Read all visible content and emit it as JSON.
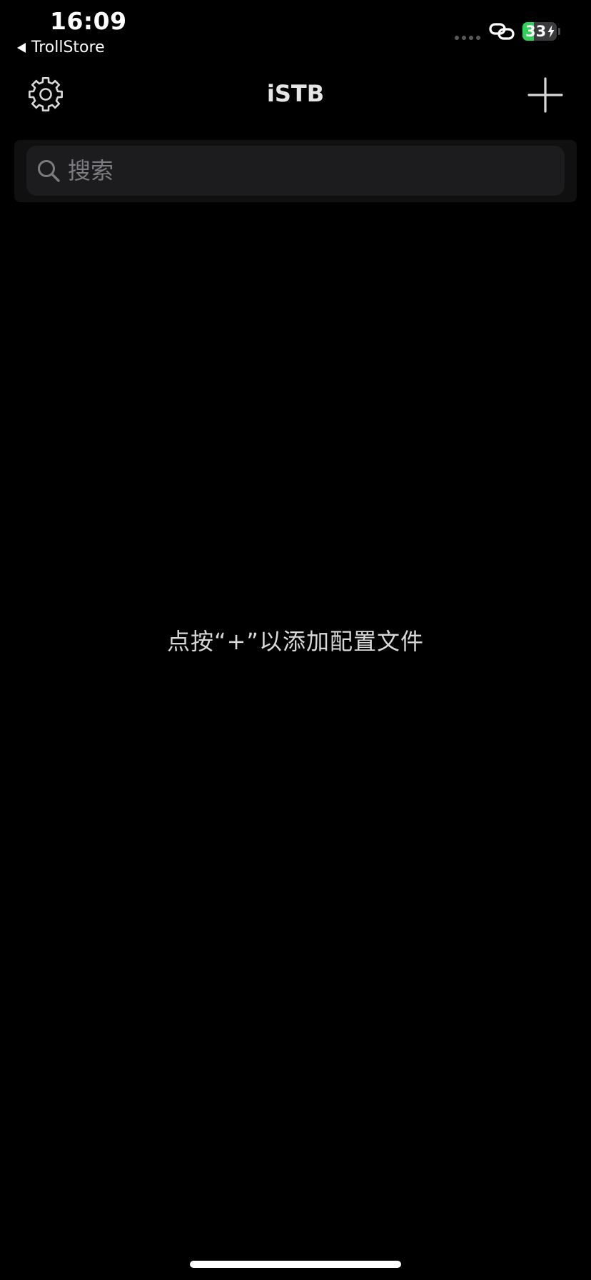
{
  "status_bar": {
    "time": "16:09",
    "back_app_label": "TrollStore",
    "battery_level": "33",
    "battery_fraction": 0.33,
    "battery_color": "#30d158",
    "charging": true,
    "icons": [
      "signal-dots-icon",
      "link-icon",
      "battery-icon",
      "bolt-icon"
    ]
  },
  "nav": {
    "title": "iSTB",
    "left_icon": "gear-icon",
    "right_icon": "plus-icon"
  },
  "search": {
    "placeholder": "搜索",
    "value": ""
  },
  "empty_state": {
    "message": "点按“+”以添加配置文件"
  }
}
